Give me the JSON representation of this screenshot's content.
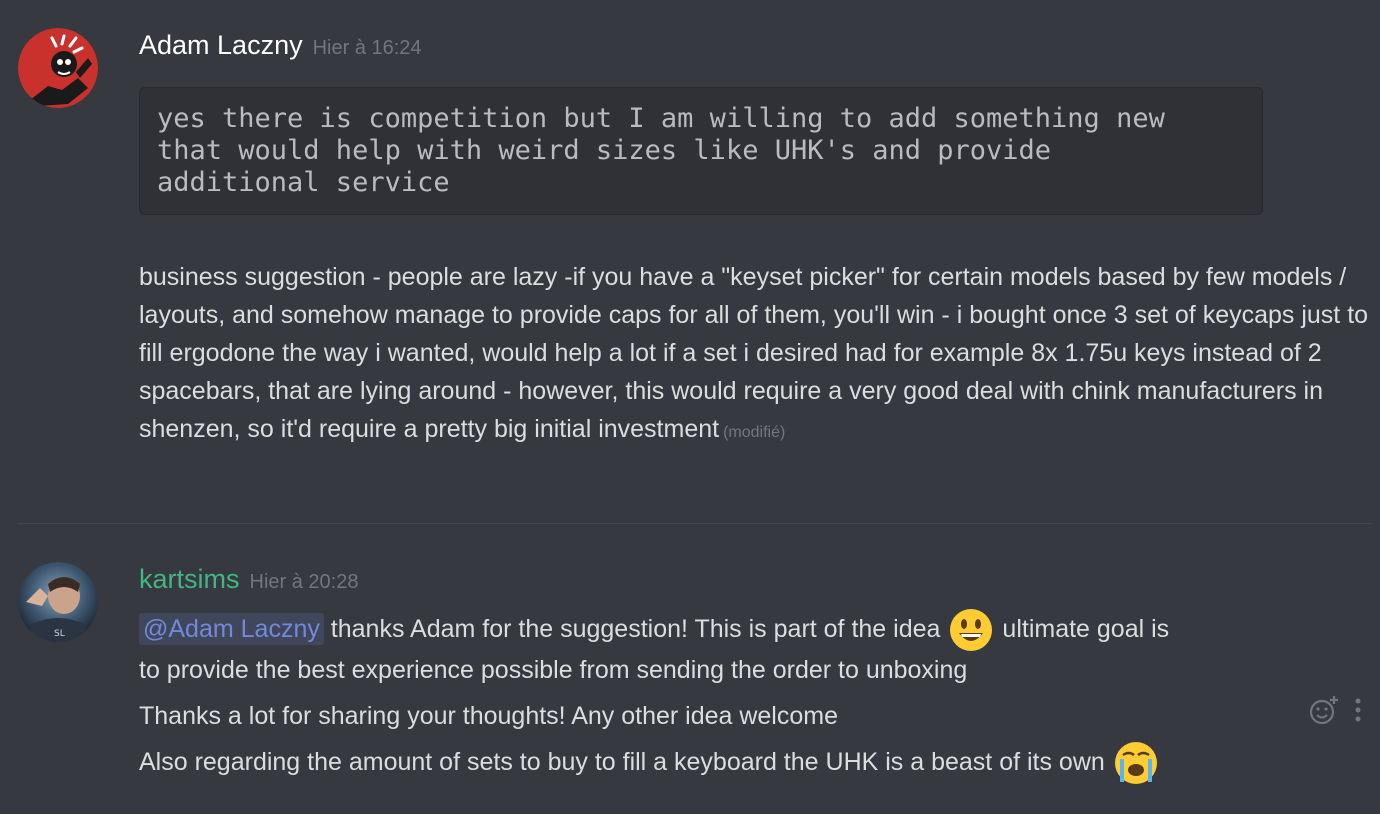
{
  "messages": [
    {
      "username": "Adam Laczny",
      "timestamp": "Hier à 16:24",
      "code": "yes there is competition but I am willing to add something new\nthat would help with weird sizes like UHK's and provide\nadditional service",
      "text": "business suggestion - people are lazy -if you have a \"keyset picker\" for certain models based by few models / layouts, and somehow manage to provide caps for all of them, you'll win - i bought once 3 set of keycaps just to  fill ergodone the way i wanted, would help a lot if a set i desired had for example 8x 1.75u keys instead of 2 spacebars, that are lying around - however, this would require a very good deal with chink manufacturers in shenzen, so it'd require  a pretty big initial investment",
      "edited_label": "(modifié)",
      "username_color": "#ffffff"
    },
    {
      "username": "kartsims",
      "timestamp": "Hier à 20:28",
      "username_color": "#43b581",
      "mention": "@Adam Laczny",
      "line1_part1": "thanks Adam for the suggestion! This is part of the idea",
      "line1_part2": "ultimate goal is",
      "line2": "to provide the best experience possible from sending the order to unboxing",
      "line3": "Thanks a lot for sharing your thoughts! Any other idea welcome",
      "line4": "Also regarding the amount of sets to buy to fill a keyboard the UHK is a beast of its own",
      "emoji1": "smiley-emoji-icon",
      "emoji2": "sob-emoji-icon"
    }
  ],
  "actions": {
    "add_reaction_icon": "add-reaction-icon",
    "more_icon": "more-options-icon"
  },
  "colors": {
    "background": "#36393f",
    "text": "#dcddde",
    "muted": "#72767d",
    "mention": "#7289da",
    "green": "#43b581"
  }
}
